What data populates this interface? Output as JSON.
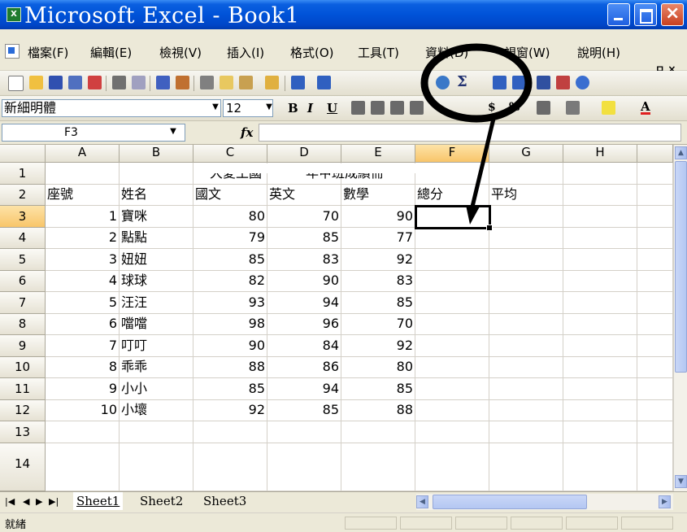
{
  "window": {
    "title": "Microsoft Excel - Book1"
  },
  "menu": {
    "items": [
      "檔案(F)",
      "編輯(E)",
      "檢視(V)",
      "插入(I)",
      "格式(O)",
      "工具(T)",
      "資料(D)",
      "視窗(W)",
      "說明(H)"
    ],
    "doc_controls": "_ ㅁ ×"
  },
  "format_toolbar": {
    "font_name": "新細明體",
    "font_size": "12",
    "currency_symbol": "$",
    "percent_symbol": "%"
  },
  "formula_bar": {
    "name_box": "F3",
    "fx_label": "fx",
    "formula": ""
  },
  "sheet": {
    "column_headers": [
      "A",
      "B",
      "C",
      "D",
      "E",
      "F",
      "G",
      "H"
    ],
    "row_headers": [
      "1",
      "2",
      "3",
      "4",
      "5",
      "6",
      "7",
      "8",
      "9",
      "10",
      "11",
      "12",
      "13",
      "14"
    ],
    "title_fragment_left": "大愛王國",
    "title_fragment_right": "一年甲班成績冊",
    "headers": [
      "座號",
      "姓名",
      "國文",
      "英文",
      "數學",
      "總分",
      "平均"
    ],
    "rows": [
      [
        "1",
        "寶咪",
        "80",
        "70",
        "90"
      ],
      [
        "2",
        "點點",
        "79",
        "85",
        "77"
      ],
      [
        "3",
        "妞妞",
        "85",
        "83",
        "92"
      ],
      [
        "4",
        "球球",
        "82",
        "90",
        "83"
      ],
      [
        "5",
        "汪汪",
        "93",
        "94",
        "85"
      ],
      [
        "6",
        "噹噹",
        "98",
        "96",
        "70"
      ],
      [
        "7",
        "叮叮",
        "90",
        "84",
        "92"
      ],
      [
        "8",
        "乖乖",
        "88",
        "86",
        "80"
      ],
      [
        "9",
        "小小",
        "85",
        "94",
        "85"
      ],
      [
        "10",
        "小壞",
        "92",
        "85",
        "88"
      ]
    ],
    "active_cell": "F3"
  },
  "tabs": {
    "sheets": [
      "Sheet1",
      "Sheet2",
      "Sheet3"
    ],
    "active": "Sheet1"
  },
  "status": {
    "text": "就緒"
  },
  "colors": {
    "titlebar": "#0053d8",
    "active_header": "#f8c56a",
    "annotation": "#000000"
  }
}
